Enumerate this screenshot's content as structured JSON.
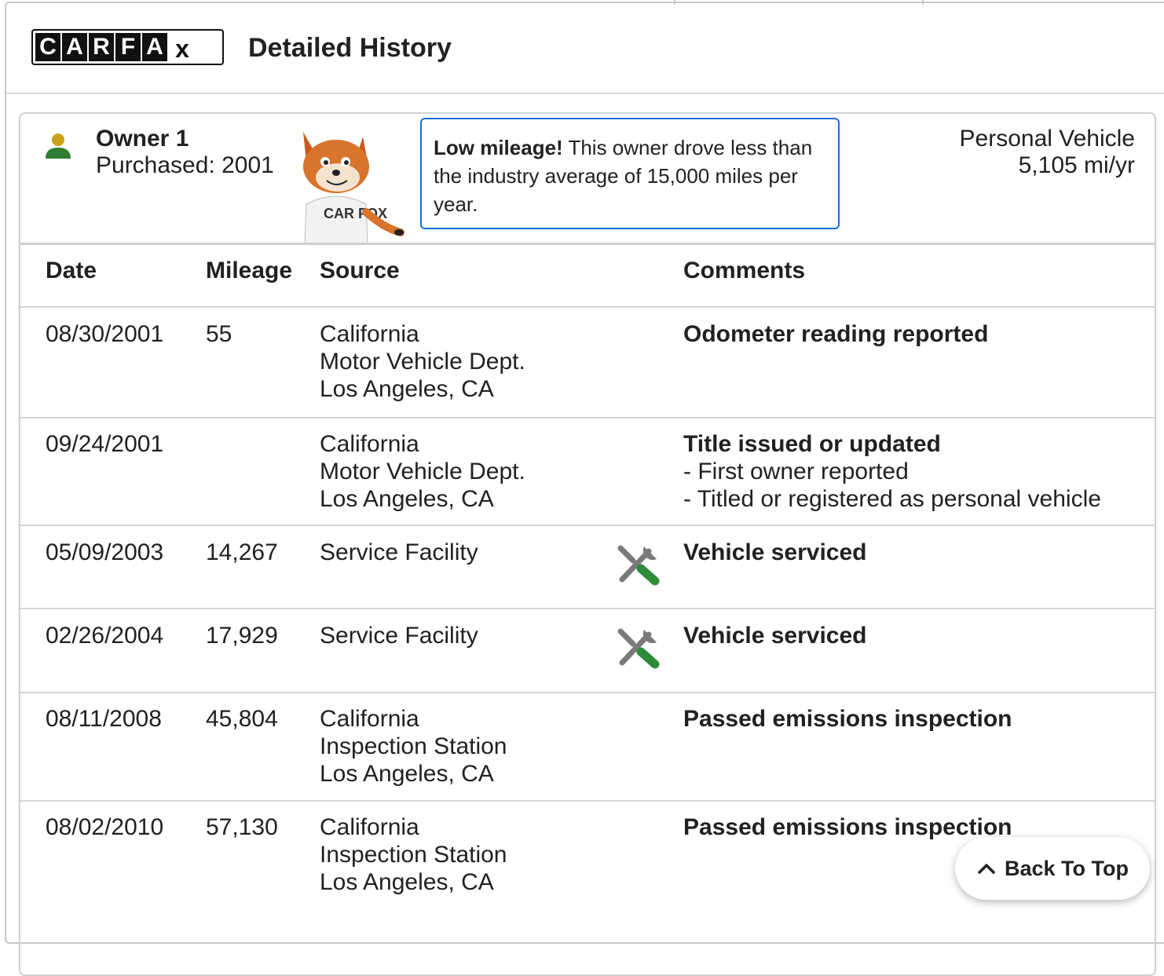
{
  "header": {
    "logo_letters": [
      "C",
      "A",
      "R",
      "F",
      "A",
      "x"
    ],
    "title": "Detailed History"
  },
  "owner": {
    "name": "Owner 1",
    "purchased": "Purchased: 2001",
    "note_bold": "Low mileage!",
    "note_text": " This owner drove less than the industry average of 15,000 miles per year.",
    "usage_type": "Personal Vehicle",
    "usage_rate": "5,105 mi/yr",
    "mascot_shirt": "CAR FOX"
  },
  "table": {
    "headers": [
      "Date",
      "Mileage",
      "Source",
      "Comments"
    ],
    "rows": [
      {
        "date": "08/30/2001",
        "mileage": "55",
        "source": [
          "California",
          "Motor Vehicle Dept.",
          "Los Angeles, CA"
        ],
        "service_icon": false,
        "comment_title": "Odometer reading reported",
        "comment_details": []
      },
      {
        "date": "09/24/2001",
        "mileage": "",
        "source": [
          "California",
          "Motor Vehicle Dept.",
          "Los Angeles, CA"
        ],
        "service_icon": false,
        "comment_title": "Title issued or updated",
        "comment_details": [
          "- First owner reported",
          "- Titled or registered as personal vehicle"
        ]
      },
      {
        "date": "05/09/2003",
        "mileage": "14,267",
        "source": [
          "Service Facility"
        ],
        "service_icon": true,
        "comment_title": "Vehicle serviced",
        "comment_details": []
      },
      {
        "date": "02/26/2004",
        "mileage": "17,929",
        "source": [
          "Service Facility"
        ],
        "service_icon": true,
        "comment_title": "Vehicle serviced",
        "comment_details": []
      },
      {
        "date": "08/11/2008",
        "mileage": "45,804",
        "source": [
          "California",
          "Inspection Station",
          "Los Angeles, CA"
        ],
        "service_icon": false,
        "comment_title": "Passed emissions inspection",
        "comment_details": []
      },
      {
        "date": "08/02/2010",
        "mileage": "57,130",
        "source": [
          "California",
          "Inspection Station",
          "Los Angeles, CA"
        ],
        "service_icon": false,
        "comment_title": "Passed emissions inspection",
        "comment_details": []
      }
    ]
  },
  "back_to_top": {
    "label": "Back To Top",
    "icon": "chevron-up-icon"
  },
  "colors": {
    "accent_blue": "#1a6ed8",
    "owner_head": "#c8a21a",
    "owner_body": "#2e7d32",
    "wrench_green": "#2e8b3a",
    "wrench_gray": "#7a7a7a"
  }
}
